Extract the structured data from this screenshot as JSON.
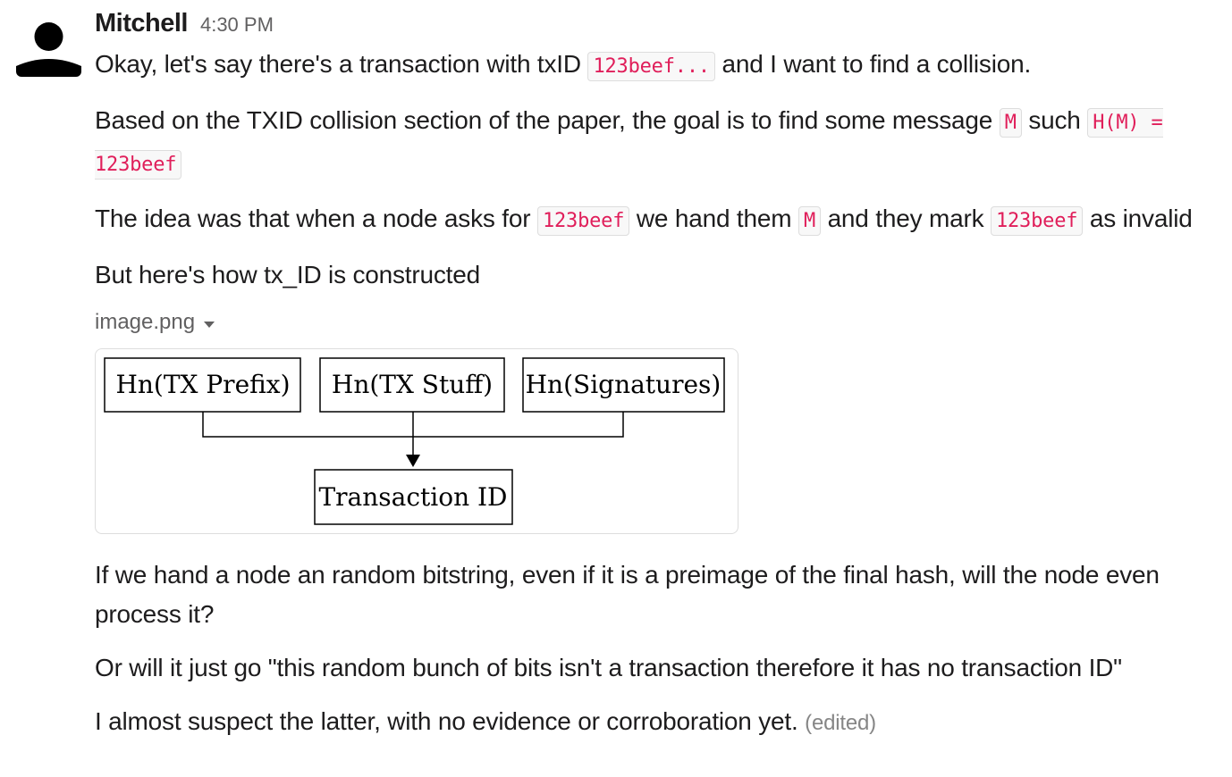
{
  "message": {
    "sender": "Mitchell",
    "time": "4:30 PM",
    "paragraphs": {
      "p1": {
        "a": "Okay, let's say there's a transaction with txID ",
        "code1": "123beef...",
        "b": " and I want to find a collision."
      },
      "p2": {
        "a": "Based on the TXID collision section of the paper, the goal is to find some message ",
        "code1": "M",
        "b": " such ",
        "code2": "H(M) = 123beef"
      },
      "p3": {
        "a": "The idea was that when a node asks for ",
        "code1": "123beef",
        "b": " we hand them ",
        "code2": "M",
        "c": " and they mark ",
        "code3": "123beef",
        "d": " as invalid"
      },
      "p4": "But here's how tx_ID is constructed",
      "p5": "If we hand a node an random bitstring, even if it is a preimage of the final hash, will the node even process it?",
      "p6": "Or will it just go \"this random bunch of bits isn't a transaction therefore it has no transaction ID\"",
      "p7": "I almost suspect the latter, with no evidence or corroboration yet.",
      "edited": "(edited)"
    },
    "attachment": {
      "filename": "image.png",
      "diagram": {
        "box1": "Hn(TX Prefix)",
        "box2": "Hn(TX Stuff)",
        "box3": "Hn(Signatures)",
        "output": "Transaction ID"
      }
    }
  },
  "icons": {
    "avatar": "user-silhouette-icon",
    "caret": "caret-down-icon"
  }
}
